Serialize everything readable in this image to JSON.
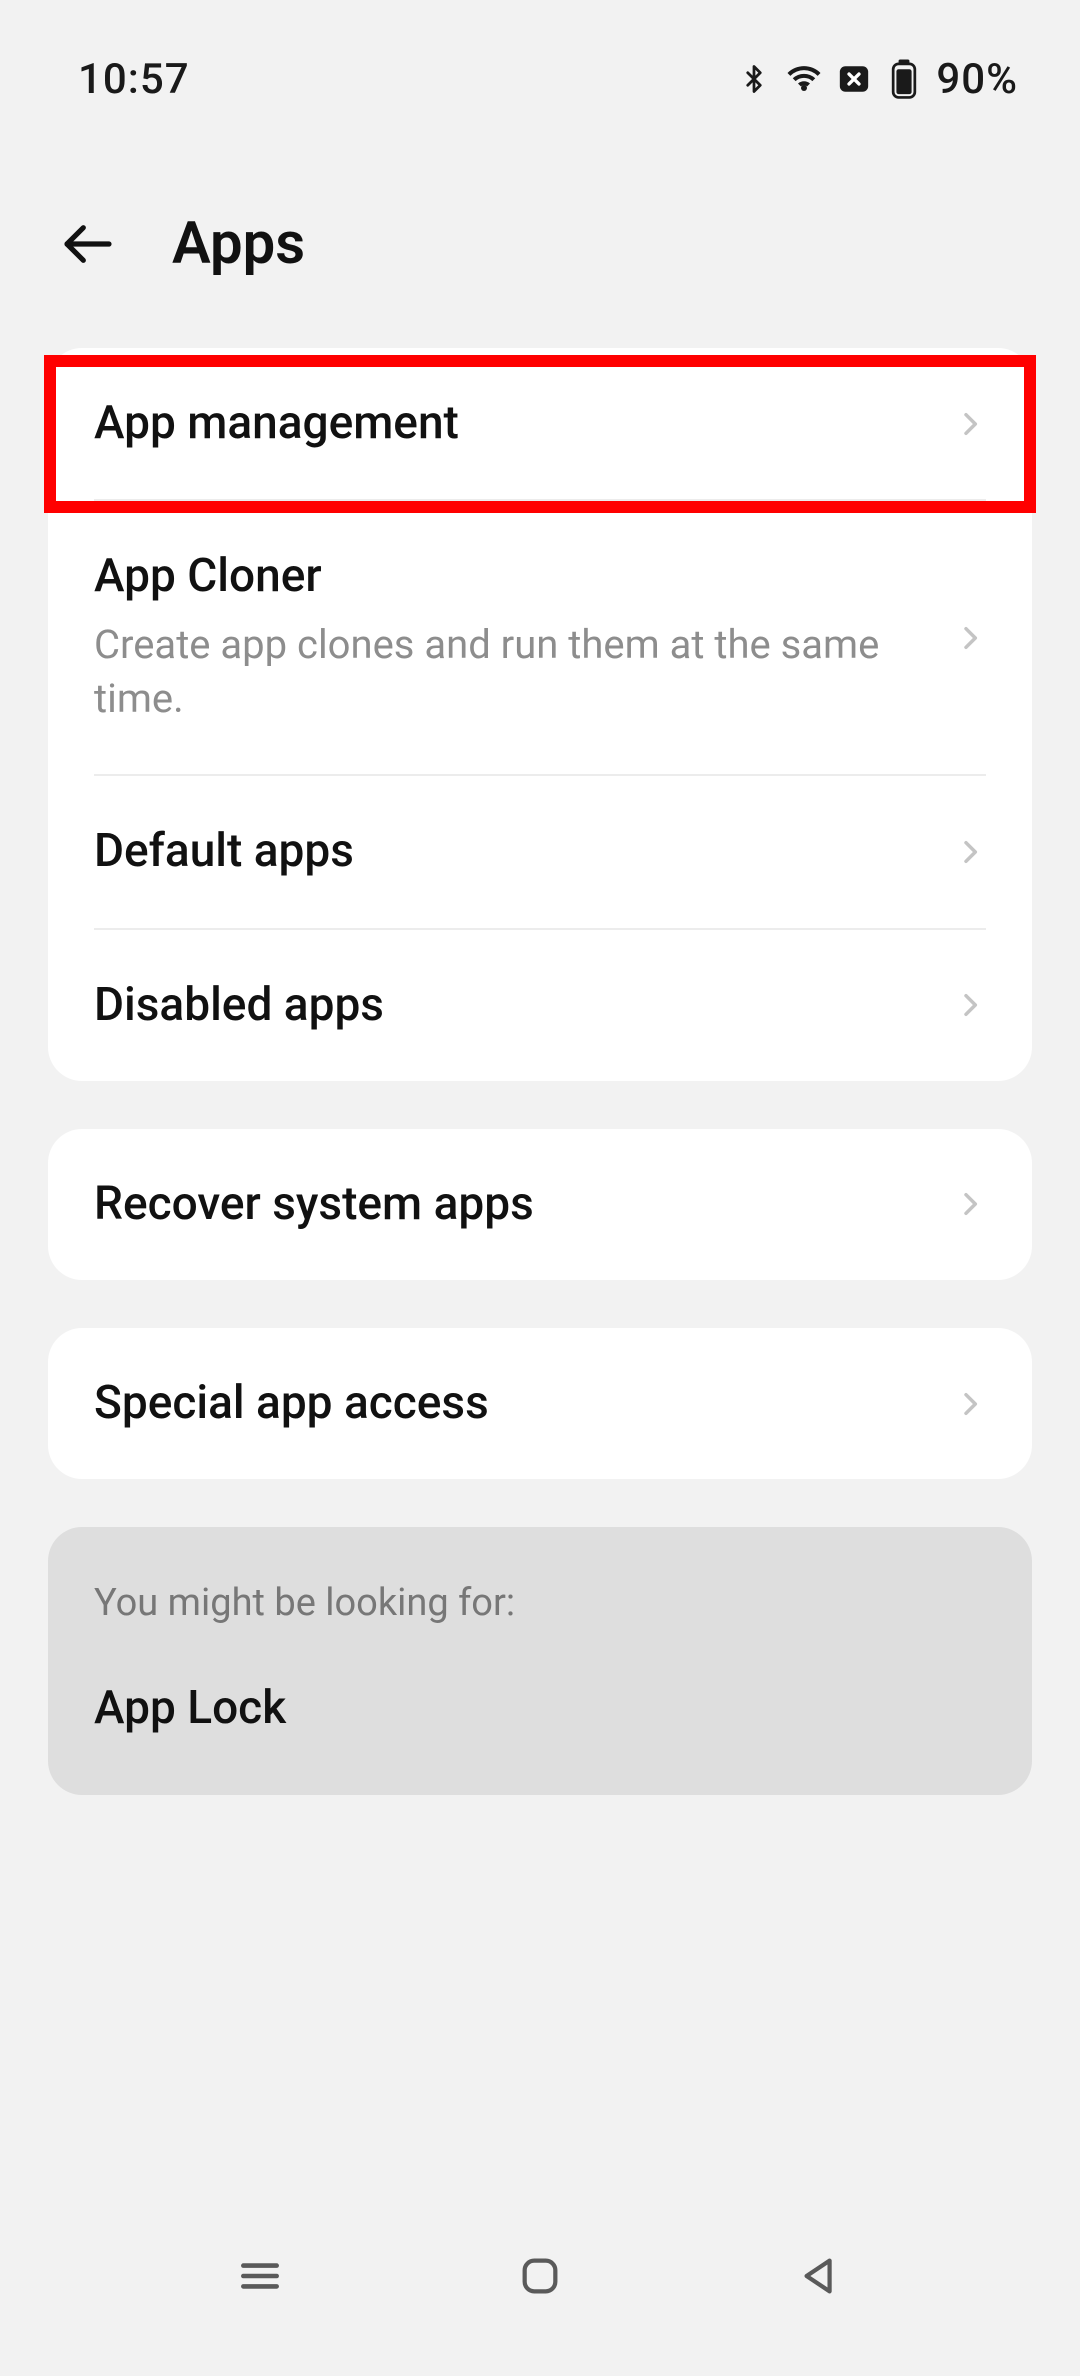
{
  "status": {
    "time": "10:57",
    "battery_pct": "90%"
  },
  "header": {
    "title": "Apps"
  },
  "groups": [
    {
      "rows": [
        {
          "title": "App management",
          "subtitle": null
        },
        {
          "title": "App Cloner",
          "subtitle": "Create app clones and run them at the same time."
        },
        {
          "title": "Default apps",
          "subtitle": null
        },
        {
          "title": "Disabled apps",
          "subtitle": null
        }
      ]
    },
    {
      "rows": [
        {
          "title": "Recover system apps",
          "subtitle": null
        }
      ]
    },
    {
      "rows": [
        {
          "title": "Special app access",
          "subtitle": null
        }
      ]
    }
  ],
  "suggest": {
    "hint": "You might be looking for:",
    "items": [
      {
        "title": "App Lock"
      }
    ]
  }
}
